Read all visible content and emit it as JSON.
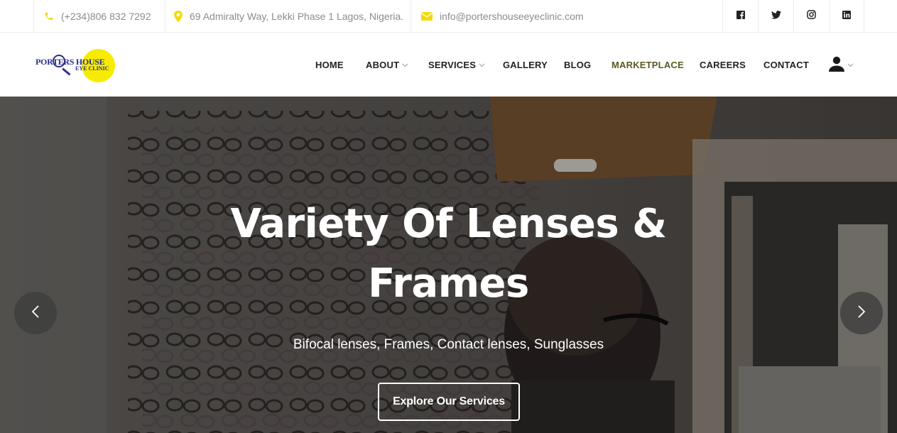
{
  "topbar": {
    "phone": "(+234)806 832 7292",
    "address": "69 Admiralty Way, Lekki Phase 1 Lagos, Nigeria.",
    "email": "info@portershouseeyeclinic.com",
    "icon_color": "#f5d90a",
    "social": [
      "facebook-icon",
      "twitter-icon",
      "instagram-icon",
      "linkedin-icon"
    ]
  },
  "logo": {
    "line1": "PORTERS HOUSE",
    "line2": "EYE CLINIC",
    "brand_yellow": "#f7ec00",
    "brand_blue": "#2c2f8e"
  },
  "nav": {
    "home": "HOME",
    "about": "ABOUT",
    "services": "SERVICES",
    "gallery": "GALLERY",
    "blog": "BLOG",
    "marketplace": "MARKETPLACE",
    "careers": "CAREERS",
    "contact": "CONTACT",
    "active_color": "#5a5a1f"
  },
  "hero": {
    "title": "Variety Of Lenses & Frames",
    "subtitle": "Bifocal lenses, Frames, Contact lenses, Sunglasses",
    "button": "Explore Our Services"
  }
}
